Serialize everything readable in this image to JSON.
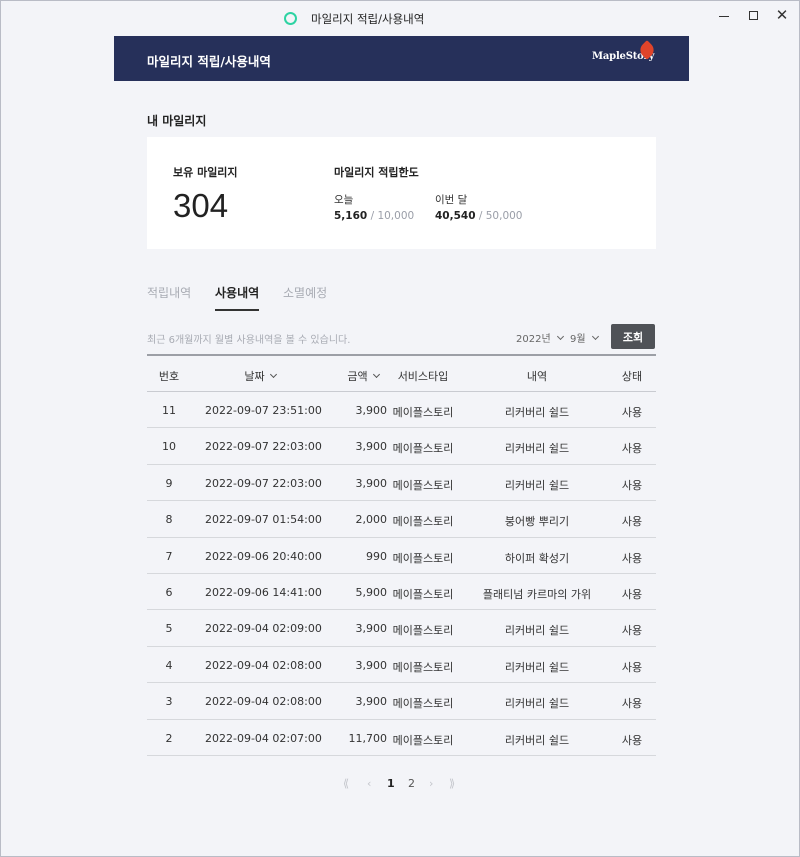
{
  "window": {
    "title": "마일리지 적립/사용내역",
    "controls": [
      "minimize-icon",
      "maximize-icon",
      "close-icon"
    ]
  },
  "header": {
    "title": "마일리지 적립/사용내역",
    "logo_text": "MapleStory",
    "brand_color": "#26305a"
  },
  "mileage": {
    "section_title": "내 마일리지",
    "owned_label": "보유 마일리지",
    "owned_value": "304",
    "limit_label": "마일리지 적립한도",
    "today_label": "오늘",
    "today_value": "5,160",
    "today_max": "/ 10,000",
    "month_label": "이번 달",
    "month_value": "40,540",
    "month_max": "/ 50,000"
  },
  "tabs": [
    {
      "label": "적립내역",
      "active": false
    },
    {
      "label": "사용내역",
      "active": true
    },
    {
      "label": "소멸예정",
      "active": false
    }
  ],
  "filter": {
    "notice": "최근 6개월까지 월별 사용내역을 볼 수 있습니다.",
    "year": "2022년",
    "month": "9월",
    "search_label": "조회"
  },
  "table": {
    "headers": {
      "no": "번호",
      "date": "날짜",
      "amount": "금액",
      "service": "서비스타입",
      "desc": "내역",
      "status": "상태"
    },
    "rows": [
      {
        "no": "11",
        "date": "2022-09-07 23:51:00",
        "amount": "3,900",
        "service": "메이플스토리",
        "desc": "리커버리 쉴드",
        "status": "사용"
      },
      {
        "no": "10",
        "date": "2022-09-07 22:03:00",
        "amount": "3,900",
        "service": "메이플스토리",
        "desc": "리커버리 쉴드",
        "status": "사용"
      },
      {
        "no": "9",
        "date": "2022-09-07 22:03:00",
        "amount": "3,900",
        "service": "메이플스토리",
        "desc": "리커버리 쉴드",
        "status": "사용"
      },
      {
        "no": "8",
        "date": "2022-09-07 01:54:00",
        "amount": "2,000",
        "service": "메이플스토리",
        "desc": "붕어빵 뿌리기",
        "status": "사용"
      },
      {
        "no": "7",
        "date": "2022-09-06 20:40:00",
        "amount": "990",
        "service": "메이플스토리",
        "desc": "하이퍼 확성기",
        "status": "사용"
      },
      {
        "no": "6",
        "date": "2022-09-06 14:41:00",
        "amount": "5,900",
        "service": "메이플스토리",
        "desc": "플래티넘 카르마의 가위",
        "status": "사용"
      },
      {
        "no": "5",
        "date": "2022-09-04 02:09:00",
        "amount": "3,900",
        "service": "메이플스토리",
        "desc": "리커버리 쉴드",
        "status": "사용"
      },
      {
        "no": "4",
        "date": "2022-09-04 02:08:00",
        "amount": "3,900",
        "service": "메이플스토리",
        "desc": "리커버리 쉴드",
        "status": "사용"
      },
      {
        "no": "3",
        "date": "2022-09-04 02:08:00",
        "amount": "3,900",
        "service": "메이플스토리",
        "desc": "리커버리 쉴드",
        "status": "사용"
      },
      {
        "no": "2",
        "date": "2022-09-04 02:07:00",
        "amount": "11,700",
        "service": "메이플스토리",
        "desc": "리커버리 쉴드",
        "status": "사용"
      }
    ]
  },
  "pagination": {
    "first": "⟪",
    "prev": "‹",
    "pages": [
      "1",
      "2"
    ],
    "current": "1",
    "next": "›",
    "last": "⟫"
  }
}
